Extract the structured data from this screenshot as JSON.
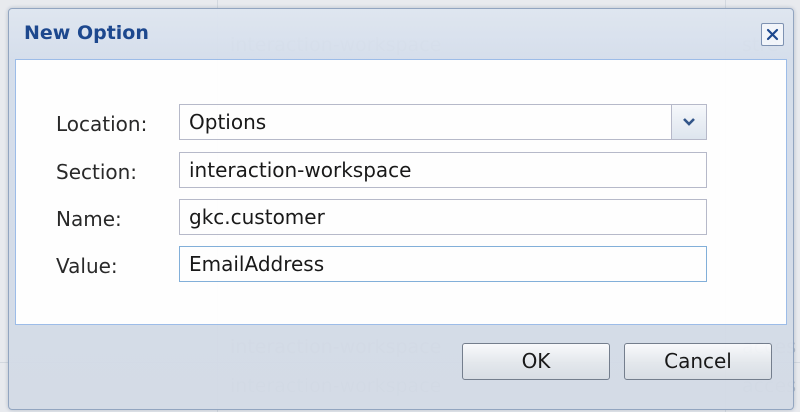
{
  "dialog": {
    "title": "New Option",
    "close_icon": "close-icon"
  },
  "form": {
    "location": {
      "label": "Location:",
      "value": "Options",
      "dropdown_icon": "chevron-down-icon"
    },
    "section": {
      "label": "Section:",
      "value": "interaction-workspace"
    },
    "name": {
      "label": "Name:",
      "value": "gkc.customer"
    },
    "value": {
      "label": "Value:",
      "value": "EmailAddress"
    }
  },
  "buttons": {
    "ok": "OK",
    "cancel": "Cancel"
  },
  "background": {
    "rows": [
      {
        "section": "interaction-workspace",
        "extra": "stre"
      },
      {
        "section": "interaction-workspace",
        "extra": "acces"
      },
      {
        "section": "interaction-workspace",
        "extra": "acces"
      }
    ]
  },
  "colors": {
    "title": "#15428b",
    "panel_border": "#99bbe8",
    "focus_border": "#7eadd9"
  }
}
